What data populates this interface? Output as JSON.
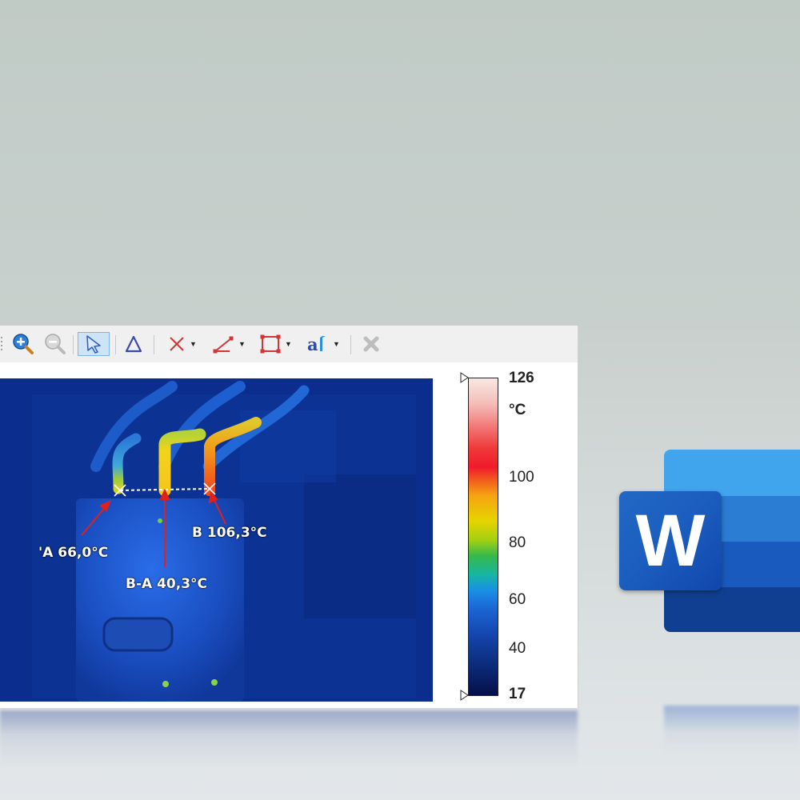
{
  "thermal_view": {
    "annotations": {
      "point_a": "'A 66,0°C",
      "point_b": "B 106,3°C",
      "delta": "B-A 40,3°C"
    },
    "color_scale": {
      "max": "126",
      "unit": "°C",
      "ticks": [
        "100",
        "80",
        "60",
        "40"
      ],
      "min": "17"
    }
  },
  "word_logo": {
    "letter": "W",
    "colors": [
      "#41a5ee",
      "#2b7cd3",
      "#185abd",
      "#103f91"
    ]
  },
  "icons": [
    "zoom-in-icon",
    "zoom-out-icon",
    "select-arrow-icon",
    "delta-icon",
    "spot-marker-icon",
    "line-tool-icon",
    "rectangle-tool-icon",
    "text-tool-icon",
    "delete-icon"
  ]
}
